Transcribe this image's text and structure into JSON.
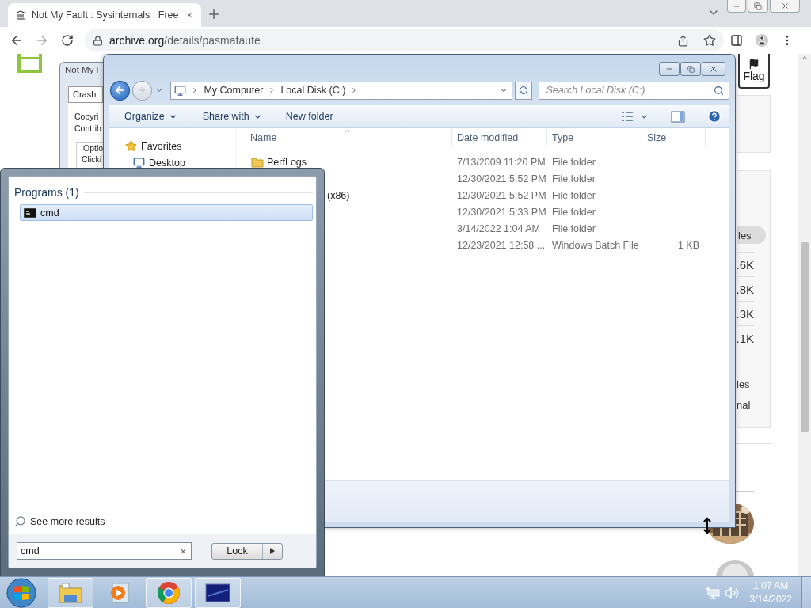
{
  "browser": {
    "tab": {
      "title": "Not My Fault : Sysinternals : Free",
      "selected": true
    },
    "url_host": "archive.org",
    "url_path": "/details/pasmafaute"
  },
  "page": {
    "flag_button": "Flag",
    "pill": "les",
    "stats": [
      ".6K",
      ".8K",
      ".3K",
      ".1K"
    ],
    "links": [
      "les",
      "nal"
    ]
  },
  "dialog": {
    "title": "Not My F",
    "tab": "Crash",
    "lines": [
      "Copyri",
      "Contrib"
    ],
    "group_label": "Optio",
    "group_text": "Clicki"
  },
  "explorer": {
    "breadcrumb": [
      "My Computer",
      "Local Disk (C:)"
    ],
    "search_placeholder": "Search Local Disk (C:)",
    "toolbar": [
      {
        "label": "Organize",
        "dropdown": true
      },
      {
        "label": "Share with",
        "dropdown": true
      },
      {
        "label": "New folder",
        "dropdown": false
      }
    ],
    "nav": [
      {
        "label": "Favorites",
        "kind": "group"
      },
      {
        "label": "Desktop",
        "kind": "item"
      }
    ],
    "columns": [
      "Name",
      "Date modified",
      "Type",
      "Size"
    ],
    "rows": [
      {
        "name": "PerfLogs",
        "partial": false,
        "date": "7/13/2009 11:20 PM",
        "type": "File folder"
      },
      {
        "date": "12/30/2021 5:52 PM",
        "type": "File folder"
      },
      {
        "name": "(x86)",
        "partial": true,
        "date": "12/30/2021 5:52 PM",
        "type": "File folder"
      },
      {
        "date": "12/30/2021 5:33 PM",
        "type": "File folder"
      },
      {
        "date": "3/14/2022 1:04 AM",
        "type": "File folder"
      },
      {
        "date": "12/23/2021 12:58 ...",
        "type": "Windows Batch File",
        "size": "1 KB"
      }
    ]
  },
  "start_menu": {
    "section": "Programs (1)",
    "results": [
      {
        "label": "cmd",
        "selected": true
      }
    ],
    "see_more": "See more results",
    "search_value": "cmd",
    "clear": "×",
    "power_button": "Lock"
  },
  "taskbar": {
    "apps": [
      {
        "kind": "explorer",
        "open": true
      },
      {
        "kind": "media",
        "open": false
      },
      {
        "kind": "chrome",
        "open": true
      },
      {
        "kind": "emulator",
        "open": true
      }
    ],
    "time": "1:07 AM",
    "date": "3/14/2022"
  }
}
